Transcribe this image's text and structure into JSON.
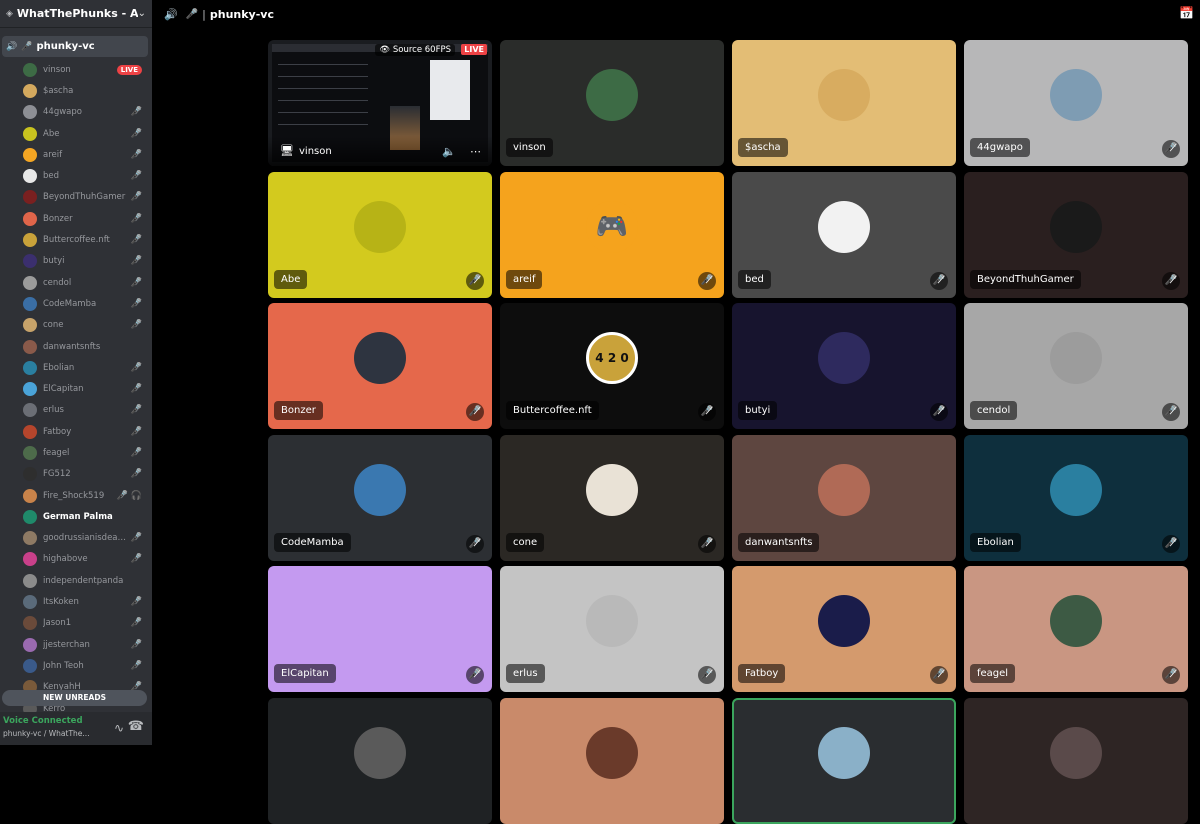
{
  "sidebar": {
    "server_name": "WhatThePhunks - Alp...",
    "channel": "phunky-vc",
    "members": [
      {
        "name": "vinson",
        "live": "LIVE",
        "muted": false,
        "avatar": "#3d6b45"
      },
      {
        "name": "$ascha",
        "muted": false,
        "avatar": "#d4a95e"
      },
      {
        "name": "44gwapo",
        "muted": true,
        "avatar": "#8d8f95"
      },
      {
        "name": "Abe",
        "muted": true,
        "avatar": "#c9c31f"
      },
      {
        "name": "areif",
        "muted": true,
        "avatar": "#f5a623"
      },
      {
        "name": "bed",
        "muted": true,
        "avatar": "#e8e8e8"
      },
      {
        "name": "BeyondThuhGamer",
        "muted": true,
        "avatar": "#7a2020"
      },
      {
        "name": "Bonzer",
        "muted": true,
        "avatar": "#e0654a"
      },
      {
        "name": "Buttercoffee.nft",
        "muted": true,
        "avatar": "#c9a23a"
      },
      {
        "name": "butyi",
        "muted": true,
        "avatar": "#3b2f6e"
      },
      {
        "name": "cendol",
        "muted": true,
        "avatar": "#9b9b9b"
      },
      {
        "name": "CodeMamba",
        "muted": true,
        "avatar": "#3a6ea5"
      },
      {
        "name": "cone",
        "muted": true,
        "avatar": "#c7a36a"
      },
      {
        "name": "danwantsnfts",
        "muted": false,
        "avatar": "#8a5a4a"
      },
      {
        "name": "Ebolian",
        "muted": true,
        "avatar": "#2a7fa0"
      },
      {
        "name": "ElCapitan",
        "muted": true,
        "avatar": "#4aa3d8"
      },
      {
        "name": "erlus",
        "muted": true,
        "avatar": "#6b6e75"
      },
      {
        "name": "Fatboy",
        "muted": true,
        "avatar": "#b5452c"
      },
      {
        "name": "feagel",
        "muted": true,
        "avatar": "#4d6b4a"
      },
      {
        "name": "FG512",
        "muted": true,
        "avatar": "#2e2e2e"
      },
      {
        "name": "Fire_Shock519",
        "muted": true,
        "deafened": true,
        "avatar": "#c9834a"
      },
      {
        "name": "German Palma",
        "muted": false,
        "bright": true,
        "avatar": "#1f8a6a"
      },
      {
        "name": "goodrussianisdeadr...",
        "muted": true,
        "avatar": "#8e7a64"
      },
      {
        "name": "highabove",
        "muted": true,
        "avatar": "#c9408a"
      },
      {
        "name": "independentpanda",
        "muted": false,
        "avatar": "#8b8b8b"
      },
      {
        "name": "ItsKoken",
        "muted": true,
        "avatar": "#5a6a7a"
      },
      {
        "name": "Jason1",
        "muted": true,
        "avatar": "#6a4a3a"
      },
      {
        "name": "jjesterchan",
        "muted": true,
        "avatar": "#9a6ab0"
      },
      {
        "name": "John Teoh",
        "muted": true,
        "avatar": "#3a5a8a"
      },
      {
        "name": "KenyahH",
        "muted": true,
        "avatar": "#7a5a3a"
      },
      {
        "name": "Kerro",
        "muted": false,
        "avatar": "#5a5a5a"
      }
    ],
    "new_unreads": "NEW UNREADS",
    "voice_status": "Voice Connected",
    "voice_channel": "phunky-vc / WhatThe..."
  },
  "topbar": {
    "channel": "phunky-vc"
  },
  "stream": {
    "name": "vinson",
    "source": "Source 60FPS",
    "live": "LIVE"
  },
  "tiles": [
    {
      "name": "vinson",
      "bg": "#2a2c2a",
      "avatar": "#3d6b45",
      "muted": false
    },
    {
      "name": "$ascha",
      "bg": "#e3bd75",
      "avatar": "#d8ac60",
      "muted": false
    },
    {
      "name": "44gwapo",
      "bg": "#b7b7b8",
      "avatar": "#7e9cb3",
      "muted": true
    },
    {
      "name": "Abe",
      "bg": "#d3ca1e",
      "avatar": "#b7b316",
      "muted": true
    },
    {
      "name": "areif",
      "bg": "#f5a31d",
      "avatar": "#f5a31d",
      "muted": true,
      "discord": true
    },
    {
      "name": "bed",
      "bg": "#4a4a4a",
      "avatar": "#f2f2f2",
      "muted": true
    },
    {
      "name": "BeyondThuhGamer",
      "bg": "#2a1f1f",
      "avatar": "#1a1a1a",
      "muted": true
    },
    {
      "name": "Bonzer",
      "bg": "#e5684b",
      "avatar": "#2e3440",
      "muted": true
    },
    {
      "name": "Buttercoffee.nft",
      "bg": "#0d0d0d",
      "avatar": "#c9a23a",
      "muted": true,
      "numbers": "4 2 0"
    },
    {
      "name": "butyi",
      "bg": "#17142e",
      "avatar": "#2e2a5e",
      "muted": true
    },
    {
      "name": "cendol",
      "bg": "#a7a7a7",
      "avatar": "#9c9c9c",
      "muted": true
    },
    {
      "name": "CodeMamba",
      "bg": "#2c2f33",
      "avatar": "#3a78b0",
      "muted": true
    },
    {
      "name": "cone",
      "bg": "#2b2824",
      "avatar": "#e9e2d6",
      "muted": true
    },
    {
      "name": "danwantsnfts",
      "bg": "#5e4640",
      "avatar": "#b06a56",
      "muted": false
    },
    {
      "name": "Ebolian",
      "bg": "#0e2f3d",
      "avatar": "#2a7fa0",
      "muted": true
    },
    {
      "name": "ElCapitan",
      "bg": "#c49af0",
      "avatar": "#c49af0",
      "muted": true
    },
    {
      "name": "erlus",
      "bg": "#c4c4c4",
      "avatar": "#b9b9b9",
      "muted": true
    },
    {
      "name": "Fatboy",
      "bg": "#d49a6d",
      "avatar": "#1a1c4a",
      "muted": true
    },
    {
      "name": "feagel",
      "bg": "#c99682",
      "avatar": "#3d5a44",
      "muted": true
    },
    {
      "name": "",
      "bg": "#1f2224",
      "avatar": "#5a5a5a",
      "muted": false
    },
    {
      "name": "",
      "bg": "#c98a6a",
      "avatar": "#6a3a2a",
      "muted": false
    },
    {
      "name": "",
      "bg": "#2a2d30",
      "avatar": "#8ab0c8",
      "muted": false,
      "speaking": true
    },
    {
      "name": "",
      "bg": "#2e2524",
      "avatar": "#5a4a4a",
      "muted": false
    }
  ]
}
